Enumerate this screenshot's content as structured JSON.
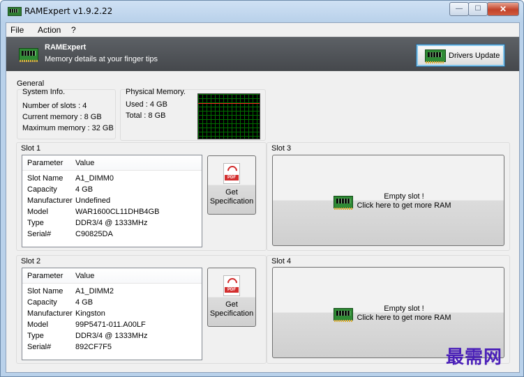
{
  "window": {
    "title": "RAMExpert v1.9.2.22",
    "minimize": "—",
    "maximize": "☐",
    "close": "✕"
  },
  "menu": [
    "File",
    "Action",
    "?"
  ],
  "header": {
    "title": "RAMExpert",
    "subtitle": "Memory details at your finger tips",
    "drivers_button": "Drivers Update"
  },
  "general": {
    "label": "General",
    "system_info": {
      "label": "System Info.",
      "slots": "Number of slots : 4",
      "current": "Current memory : 8 GB",
      "maximum": "Maximum memory : 32 GB"
    },
    "physical_memory": {
      "label": "Physical Memory.",
      "used": "Used : 4 GB",
      "total": "Total : 8 GB"
    }
  },
  "table_headers": {
    "parameter": "Parameter",
    "value": "Value"
  },
  "spec_button": {
    "badge": "PDF",
    "label_line1": "Get",
    "label_line2": "Specification"
  },
  "slots": [
    {
      "label": "Slot 1",
      "rows": [
        [
          "Slot Name",
          "A1_DIMM0"
        ],
        [
          "Capacity",
          "4 GB"
        ],
        [
          "Manufacturer",
          "Undefined"
        ],
        [
          "Model",
          "WAR1600CL11DHB4GB"
        ],
        [
          "Type",
          "DDR3/4 @ 1333MHz"
        ],
        [
          "Serial#",
          "C90825DA"
        ]
      ]
    },
    {
      "label": "Slot 2",
      "rows": [
        [
          "Slot Name",
          "A1_DIMM2"
        ],
        [
          "Capacity",
          "4 GB"
        ],
        [
          "Manufacturer",
          "Kingston"
        ],
        [
          "Model",
          "99P5471-011.A00LF"
        ],
        [
          "Type",
          "DDR3/4 @ 1333MHz"
        ],
        [
          "Serial#",
          "892CF7F5"
        ]
      ]
    }
  ],
  "empty_slots": [
    {
      "label": "Slot 3",
      "line1": "Empty slot !",
      "line2": "Click here to get more RAM"
    },
    {
      "label": "Slot 4",
      "line1": "Empty slot !",
      "line2": "Click here to get more RAM"
    }
  ],
  "watermark": "最需网"
}
